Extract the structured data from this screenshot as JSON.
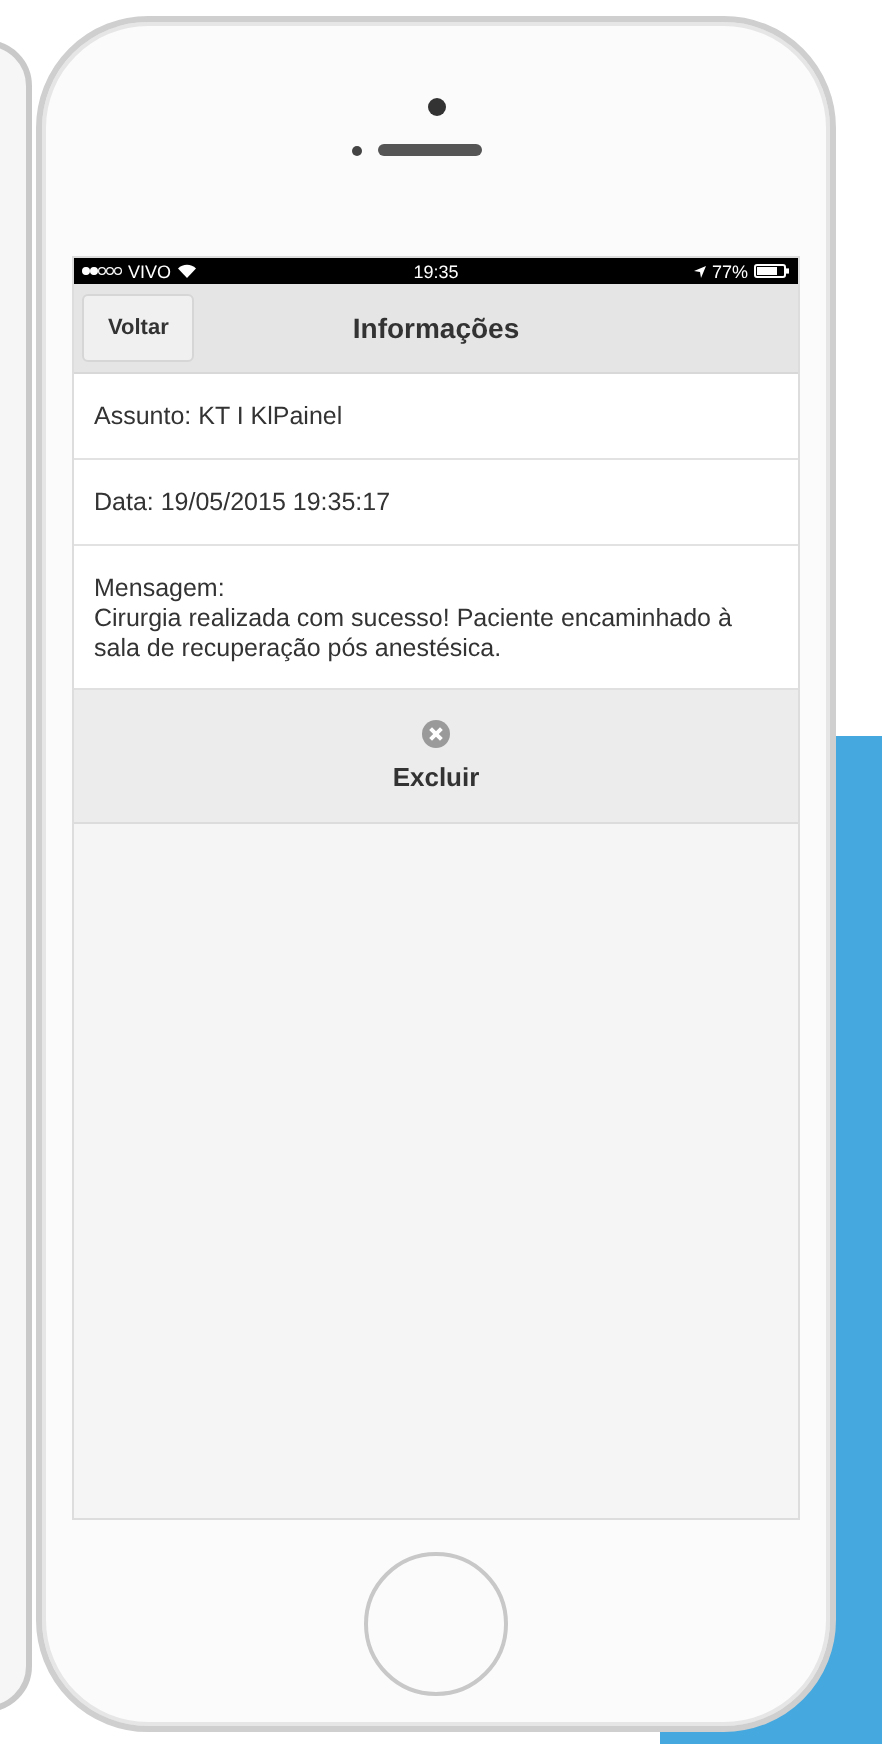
{
  "status_bar": {
    "carrier": "VIVO",
    "time": "19:35",
    "battery": "77%"
  },
  "nav_bar": {
    "back_button": "Voltar",
    "title": "Informações"
  },
  "fields": [
    "Assunto: KT I KlPainel",
    "Data: 19/05/2015 19:35:17"
  ],
  "message": {
    "label": "Mensagem:",
    "body": "Cirurgia realizada com sucesso! Paciente encaminhado à sala de recuperação pós anestésica."
  },
  "actions": [
    {
      "label": "Excluir"
    }
  ]
}
